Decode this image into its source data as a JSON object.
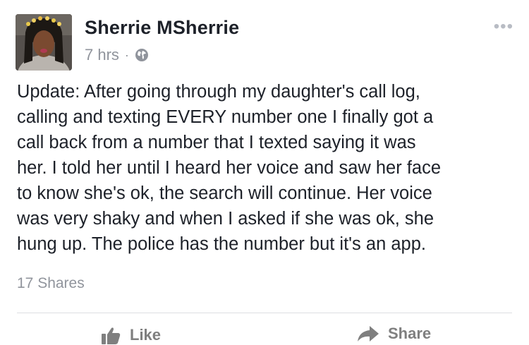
{
  "post": {
    "author": "Sherrie MSherrie",
    "time": "7 hrs",
    "separator": "·",
    "privacy_icon": "globe-icon",
    "more_icon": "more-options-icon",
    "more_glyph": "•••",
    "body": "Update: After going through my daughter's call log,\ncalling and texting EVERY number one I finally got a\ncall back from a number that I texted saying it was\nher. I told her until I heard her voice and saw her face\nto know she's ok, the search will continue. Her voice\nwas very shaky and when I asked if she was ok, she\nhung up. The police has the number but it's an app.",
    "shares": "17 Shares"
  },
  "actions": {
    "like_label": "Like",
    "like_icon": "thumbs-up-icon",
    "share_label": "Share",
    "share_icon": "share-arrow-icon"
  },
  "colors": {
    "text": "#1d2129",
    "meta": "#90949c",
    "divider": "#dddfe2",
    "action": "#7f7f7f"
  }
}
